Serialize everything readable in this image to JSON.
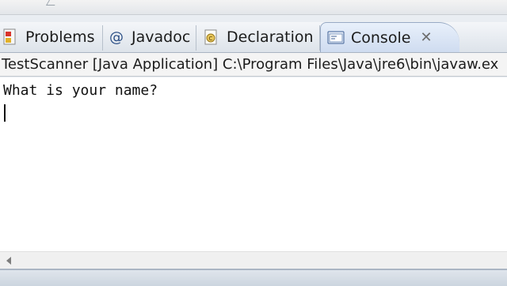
{
  "tabs": [
    {
      "label": "Problems",
      "icon": "problems-icon"
    },
    {
      "label": "Javadoc",
      "icon": "at-icon"
    },
    {
      "label": "Declaration",
      "icon": "declaration-icon"
    },
    {
      "label": "Console",
      "icon": "console-icon",
      "active": true
    }
  ],
  "console": {
    "title": "TestScanner [Java Application] C:\\Program Files\\Java\\jre6\\bin\\javaw.ex",
    "output_line": "What is your name?"
  },
  "colors": {
    "active_tab": "#cfdcf0",
    "tabbar_border": "#a9b4c2",
    "console_bg": "#ffffff"
  }
}
